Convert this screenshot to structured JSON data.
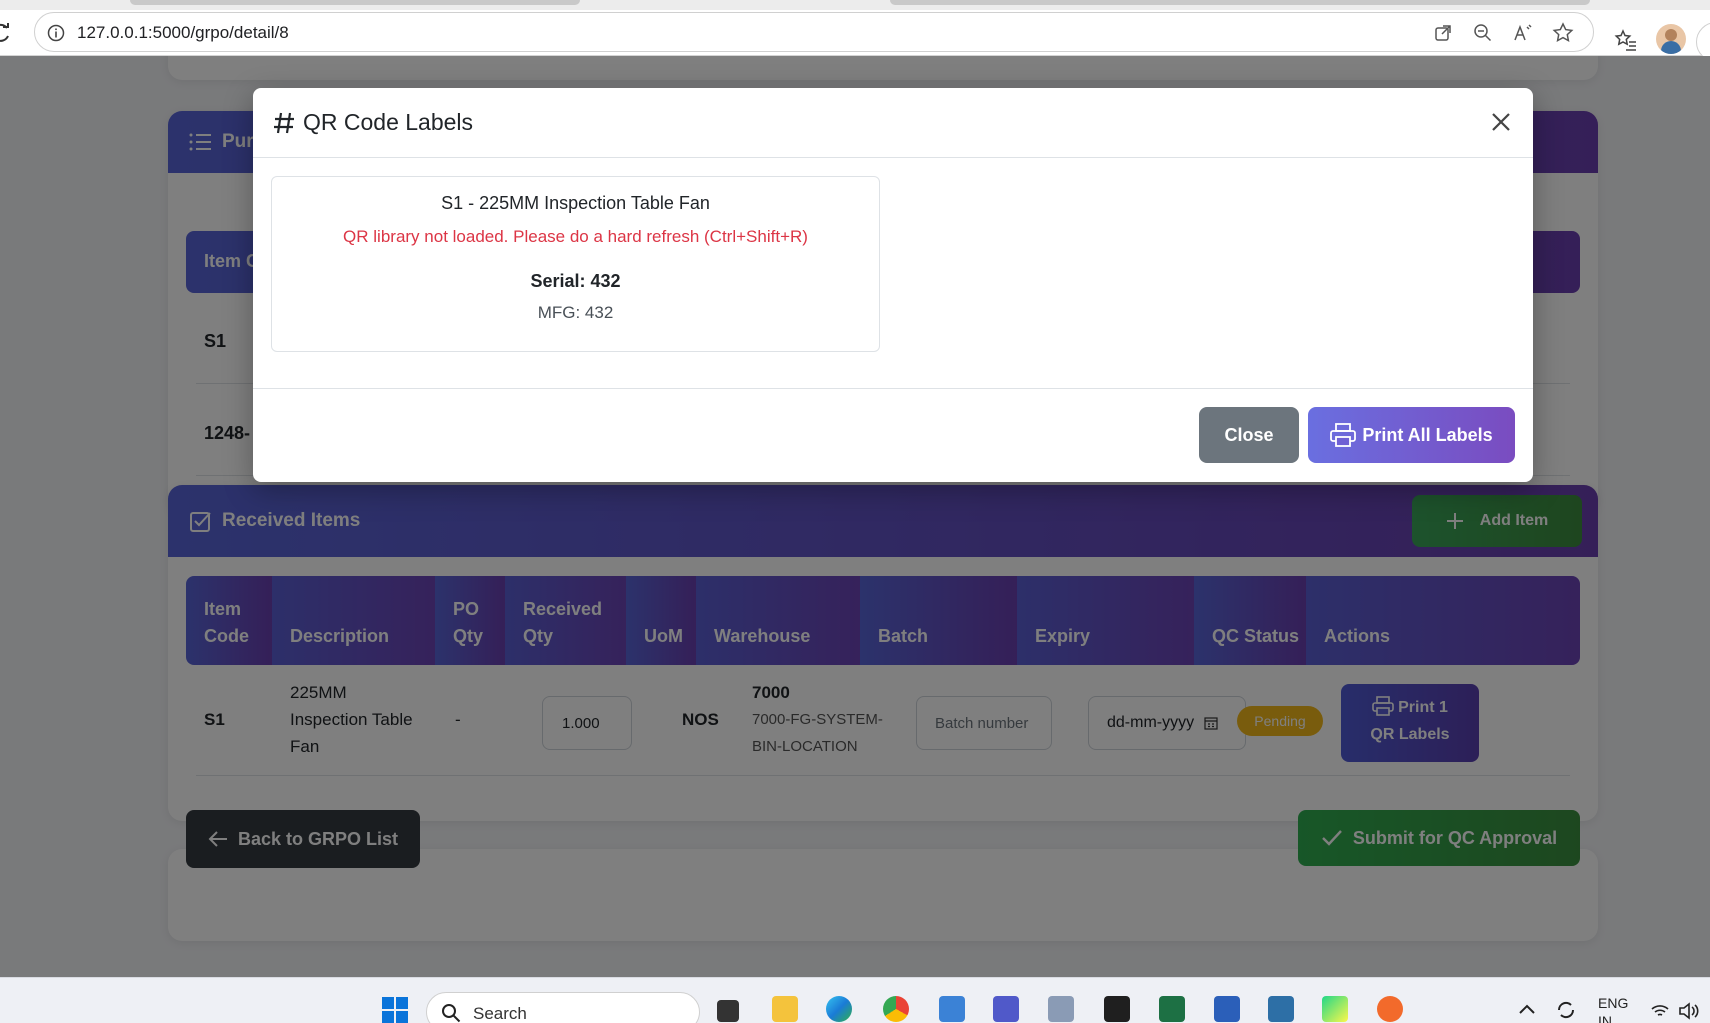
{
  "browser": {
    "url": "127.0.0.1:5000/grpo/detail/8"
  },
  "po_section": {
    "title": "Purc",
    "header_cell": "Item C",
    "rows": [
      "S1",
      "1248-"
    ]
  },
  "received": {
    "title": "Received Items",
    "add_button": "Add Item",
    "headers": [
      {
        "line1": "Item",
        "line2": "Code"
      },
      {
        "line1": "",
        "line2": "Description"
      },
      {
        "line1": "PO",
        "line2": "Qty"
      },
      {
        "line1": "Received",
        "line2": "Qty"
      },
      {
        "line1": "",
        "line2": "UoM"
      },
      {
        "line1": "",
        "line2": "Warehouse"
      },
      {
        "line1": "",
        "line2": "Batch"
      },
      {
        "line1": "",
        "line2": "Expiry"
      },
      {
        "line1": "",
        "line2": "QC Status"
      },
      {
        "line1": "",
        "line2": "Actions"
      }
    ],
    "row": {
      "item_code": "S1",
      "description_l1": "225MM",
      "description_l2": "Inspection Table",
      "description_l3": "Fan",
      "po_qty": "-",
      "received_qty": "1.000",
      "uom": "NOS",
      "warehouse_code": "7000",
      "warehouse_l1": "7000-FG-SYSTEM-",
      "warehouse_l2": "BIN-LOCATION",
      "batch_placeholder": "Batch number",
      "expiry_placeholder": "dd-mm-yyyy",
      "qc_status": "Pending",
      "print_l1": "Print 1",
      "print_l2": "QR Labels"
    }
  },
  "footer": {
    "back_button": "Back to GRPO List",
    "submit_button": "Submit for QC Approval"
  },
  "modal": {
    "title": "QR Code Labels",
    "label": {
      "title": "S1 - 225MM Inspection Table Fan",
      "error": "QR library not loaded. Please do a hard refresh (Ctrl+Shift+R)",
      "serial": "Serial: 432",
      "mfg": "MFG: 432"
    },
    "close_button": "Close",
    "print_all_button": "Print All Labels"
  },
  "taskbar": {
    "search": "Search",
    "lang_l1": "ENG",
    "lang_l2": "IN"
  },
  "colors": {
    "header_gradient_start": "#5865d8",
    "header_gradient_end": "#6a3fb0",
    "error": "#dc3545",
    "pending_badge": "#f2b91a",
    "success": "#3aa65a"
  }
}
